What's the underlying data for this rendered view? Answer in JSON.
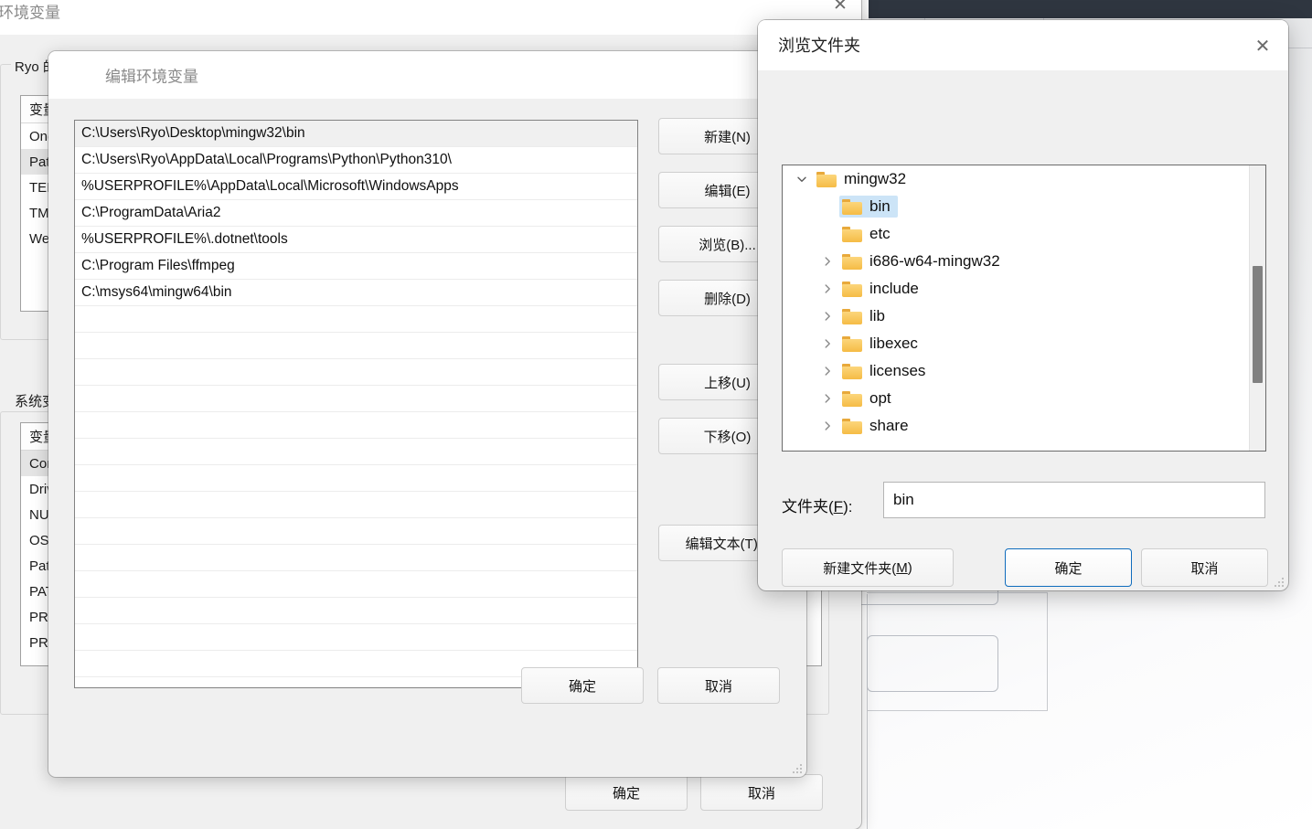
{
  "env_window": {
    "title": "环境变量",
    "close_icon": "✕",
    "user_group_legend": "Ryo 的用户变量",
    "system_group_legend": "系统变量",
    "column_header": "变量",
    "user_variables": [
      "OneDrive",
      "Path",
      "TEMP",
      "TMP",
      "WeChat"
    ],
    "user_selected": "Path",
    "system_variables": [
      "ComSpec",
      "DriverData",
      "NUMBER_OF_PROCESSORS",
      "OS",
      "Path",
      "PATHEXT",
      "PROCESSOR_ARCHITECTURE",
      "PROCESSOR_IDENTIFIER"
    ],
    "system_selected": "ComSpec",
    "ok_label": "确定",
    "cancel_label": "取消"
  },
  "edit_dialog": {
    "title": "编辑环境变量",
    "paths": [
      "C:\\Users\\Ryo\\Desktop\\mingw32\\bin",
      "C:\\Users\\Ryo\\AppData\\Local\\Programs\\Python\\Python310\\",
      "%USERPROFILE%\\AppData\\Local\\Microsoft\\WindowsApps",
      "C:\\ProgramData\\Aria2",
      "%USERPROFILE%\\.dotnet\\tools",
      "C:\\Program Files\\ffmpeg",
      "C:\\msys64\\mingw64\\bin"
    ],
    "selected_index": 0,
    "side_buttons": [
      {
        "label": "新建(N)",
        "name": "new-button"
      },
      {
        "label": "编辑(E)",
        "name": "edit-button"
      },
      {
        "label": "浏览(B)...",
        "name": "browse-button"
      },
      {
        "label": "删除(D)",
        "name": "delete-button"
      },
      {
        "label": "上移(U)",
        "name": "move-up-button"
      },
      {
        "label": "下移(O)",
        "name": "move-down-button"
      },
      {
        "label": "编辑文本(T)...",
        "name": "edit-text-button"
      }
    ],
    "ok_label": "确定",
    "cancel_label": "取消"
  },
  "browse_dialog": {
    "title": "浏览文件夹",
    "close_icon": "✕",
    "tree": [
      {
        "label": "mingw32",
        "depth": 0,
        "chevron": "expanded",
        "selected": false
      },
      {
        "label": "bin",
        "depth": 1,
        "chevron": "none",
        "selected": true
      },
      {
        "label": "etc",
        "depth": 1,
        "chevron": "none",
        "selected": false
      },
      {
        "label": "i686-w64-mingw32",
        "depth": 1,
        "chevron": "collapsed",
        "selected": false
      },
      {
        "label": "include",
        "depth": 1,
        "chevron": "collapsed",
        "selected": false
      },
      {
        "label": "lib",
        "depth": 1,
        "chevron": "collapsed",
        "selected": false
      },
      {
        "label": "libexec",
        "depth": 1,
        "chevron": "collapsed",
        "selected": false
      },
      {
        "label": "licenses",
        "depth": 1,
        "chevron": "collapsed",
        "selected": false
      },
      {
        "label": "opt",
        "depth": 1,
        "chevron": "collapsed",
        "selected": false
      },
      {
        "label": "share",
        "depth": 1,
        "chevron": "collapsed",
        "selected": false
      }
    ],
    "folder_label_prefix": "文件夹(",
    "folder_label_accel": "F",
    "folder_label_suffix": "):",
    "folder_value": "bin",
    "new_folder_prefix": "新建文件夹(",
    "new_folder_accel": "M",
    "new_folder_suffix": ")",
    "ok_label": "确定",
    "cancel_label": "取消"
  },
  "colors": {
    "accent": "#0f6cbd",
    "selection": "#cce4f7",
    "folder": "#f5bb45",
    "dark_bar": "#2f3640"
  }
}
